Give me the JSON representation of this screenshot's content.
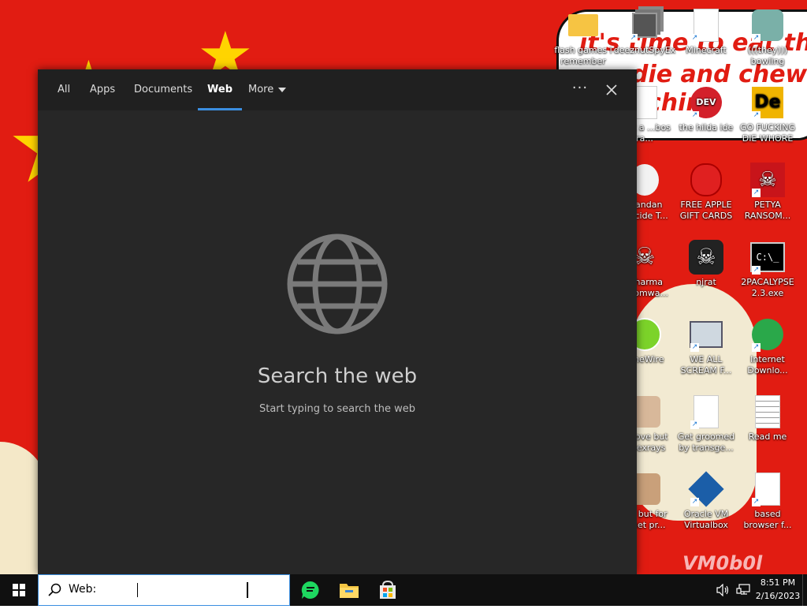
{
  "desktop": {
    "banner_lines": [
      "it's time to eat this",
      "die and chew",
      "ching"
    ],
    "vm_text": "VM0b0l",
    "icons": [
      {
        "label": "flash games i remember",
        "icon": "folder-icon"
      },
      {
        "label": "deeznutSpyEx",
        "icon": "app-stack-icon"
      },
      {
        "label": "Minecraft",
        "icon": "file-icon"
      },
      {
        "label": "(((they))) bowling",
        "icon": "clown-icon"
      },
      {
        "label": "that a ...bos ra...",
        "icon": "file-icon"
      },
      {
        "label": "the hilda ide",
        "icon": "devcpp-icon"
      },
      {
        "label": "GO FUCKING DIE WHORE",
        "icon": "de-icon"
      },
      {
        "label": "...andan ...ocide T...",
        "icon": "face-icon"
      },
      {
        "label": "FREE APPLE GIFT CARDS",
        "icon": "apple-icon"
      },
      {
        "label": "PETYA RANSOM...",
        "icon": "skull-icon"
      },
      {
        "label": "...harma ...somwa...",
        "icon": "skull-icon"
      },
      {
        "label": "njrat",
        "icon": "skull-icon"
      },
      {
        "label": "2PACALYPSE 2.3.exe",
        "icon": "cmd-icon"
      },
      {
        "label": "...neWire",
        "icon": "limewire-icon"
      },
      {
        "label": "WE ALL SCREAM F...",
        "icon": "computer-icon"
      },
      {
        "label": "Internet Downlo...",
        "icon": "idm-icon"
      },
      {
        "label": "...bove but ...sexrays",
        "icon": "photo-icon"
      },
      {
        "label": "Get groomed by transge...",
        "icon": "file-icon"
      },
      {
        "label": "Read me",
        "icon": "text-file-icon"
      },
      {
        "label": "...y but for ...net pr...",
        "icon": "photo-icon"
      },
      {
        "label": "Oracle VM Virtualbox",
        "icon": "virtualbox-icon"
      },
      {
        "label": "based browser f...",
        "icon": "file-icon"
      }
    ]
  },
  "search_panel": {
    "tabs": [
      {
        "label": "All"
      },
      {
        "label": "Apps"
      },
      {
        "label": "Documents"
      },
      {
        "label": "Web"
      },
      {
        "label": "More"
      }
    ],
    "active_tab": "Web",
    "ellipsis": "···",
    "hero_title": "Search the web",
    "hero_subtitle": "Start typing to search the web"
  },
  "taskbar": {
    "search_value": "Web: ",
    "apps": [
      "chat-icon",
      "file-explorer-icon",
      "store-icon"
    ],
    "time": "8:51 PM",
    "date": "2/16/2023"
  },
  "colors": {
    "accent": "#3b8ee0",
    "panel_bg": "#272727",
    "header_bg": "#202020",
    "taskbar_bg": "#101010",
    "desktop_red": "#e11c12"
  }
}
